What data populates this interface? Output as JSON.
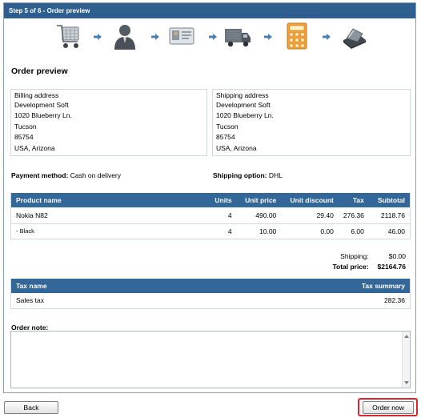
{
  "header": {
    "title": "Step 5 of 6 - Order preview"
  },
  "steps": [
    {
      "icon": "shopping-cart-icon"
    },
    {
      "icon": "customer-person-icon"
    },
    {
      "icon": "id-card-icon"
    },
    {
      "icon": "delivery-truck-icon"
    },
    {
      "icon": "calculator-icon"
    },
    {
      "icon": "credit-card-swipe-icon"
    }
  ],
  "page": {
    "title": "Order preview"
  },
  "billing": {
    "title": "Billing address",
    "lines": [
      "Development Soft",
      "1020 Blueberry Ln.",
      "Tucson",
      "85754",
      "USA, Arizona"
    ]
  },
  "shipping_address": {
    "title": "Shipping address",
    "lines": [
      "Development Soft",
      "1020 Blueberry Ln.",
      "Tucson",
      "85754",
      "USA, Arizona"
    ]
  },
  "payment": {
    "label": "Payment method:",
    "value": "Cash on delivery"
  },
  "shipping_option": {
    "label": "Shipping option:",
    "value": "DHL"
  },
  "items_table": {
    "headers": [
      "Product name",
      "Units",
      "Unit price",
      "Unit discount",
      "Tax",
      "Subtotal"
    ],
    "rows": [
      [
        "Nokia N82",
        "4",
        "490.00",
        "29.40",
        "276.36",
        "2118.76"
      ],
      [
        "- Black",
        "4",
        "10.00",
        "0.00",
        "6.00",
        "46.00"
      ]
    ]
  },
  "totals": {
    "shipping_label": "Shipping:",
    "shipping_value": "$0.00",
    "total_label": "Total price:",
    "total_value": "$2164.76"
  },
  "tax_table": {
    "headers": [
      "Tax name",
      "Tax summary"
    ],
    "rows": [
      [
        "Sales tax",
        "282.36"
      ]
    ]
  },
  "order_note": {
    "label": "Order note:",
    "value": ""
  },
  "buttons": {
    "back": "Back",
    "order_now": "Order now"
  },
  "colors": {
    "header_bg": "#2f5f8f",
    "table_header_bg": "#336699",
    "highlight_border": "#d9262c"
  }
}
